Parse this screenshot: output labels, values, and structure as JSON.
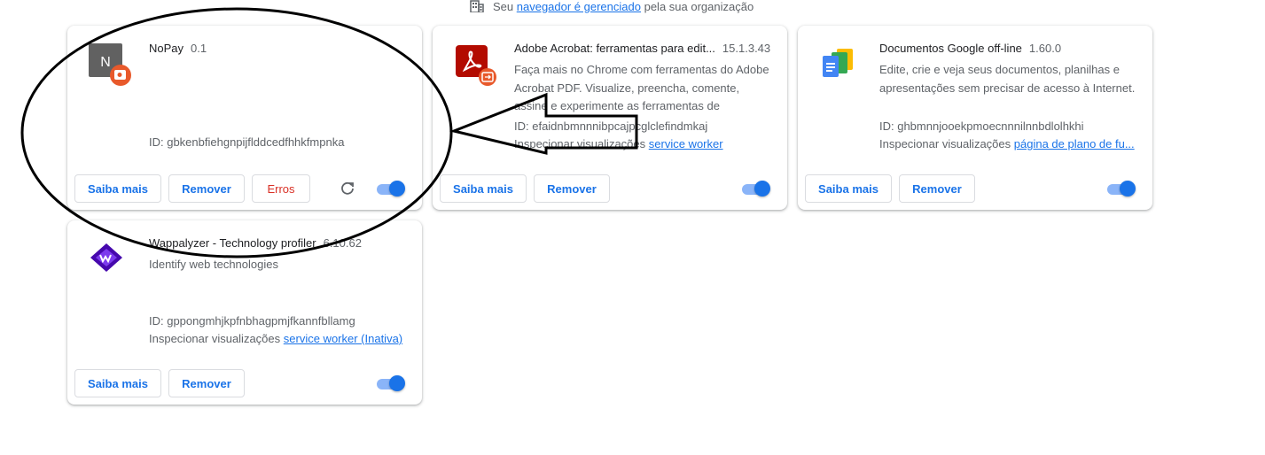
{
  "managed": {
    "prefix": "Seu ",
    "link": "navegador é gerenciado",
    "suffix": " pela sua organização"
  },
  "cards": [
    {
      "name": "NoPay",
      "version": "0.1",
      "description": "",
      "id": "ID: gbkenbfiehgnpijflddcedfhhkfmpnka",
      "buttons": {
        "details": "Saiba mais",
        "remove": "Remover",
        "errors": "Erros"
      },
      "enabled": true,
      "icon_letter": "N"
    },
    {
      "name": "Adobe Acrobat: ferramentas para edit...",
      "version": "15.1.3.43",
      "description": "Faça mais no Chrome com ferramentas do Adobe Acrobat PDF. Visualize, preencha, comente, assine e experimente as ferramentas de",
      "id": "ID: efaidnbmnnnibpcajpcglclefindmkaj",
      "inspect_label": "Inspecionar visualizações",
      "inspect_link": "service worker",
      "buttons": {
        "details": "Saiba mais",
        "remove": "Remover"
      },
      "enabled": true
    },
    {
      "name": "Documentos Google off-line",
      "version": "1.60.0",
      "description": "Edite, crie e veja seus documentos, planilhas e apresentações sem precisar de acesso à Internet.",
      "id": "ID: ghbmnnjooekpmoecnnnilnnbdlolhkhi",
      "inspect_label": "Inspecionar visualizações",
      "inspect_link": "página de plano de fu...",
      "buttons": {
        "details": "Saiba mais",
        "remove": "Remover"
      },
      "enabled": true
    },
    {
      "name": "Wappalyzer - Technology profiler",
      "version": "6.10.62",
      "description": "Identify web technologies",
      "id": "ID: gppongmhjkpfnbhagpmjfkannfbllamg",
      "inspect_label": "Inspecionar visualizações",
      "inspect_link": "service worker (Inativa)",
      "buttons": {
        "details": "Saiba mais",
        "remove": "Remover"
      },
      "enabled": true
    }
  ],
  "colors": {
    "accent": "#1a73e8",
    "error": "#d93025",
    "annotation": "#000000"
  },
  "icons": [
    "building-icon",
    "nopay-icon",
    "adobe-acrobat-icon",
    "google-docs-icon",
    "wappalyzer-icon",
    "reload-icon"
  ]
}
